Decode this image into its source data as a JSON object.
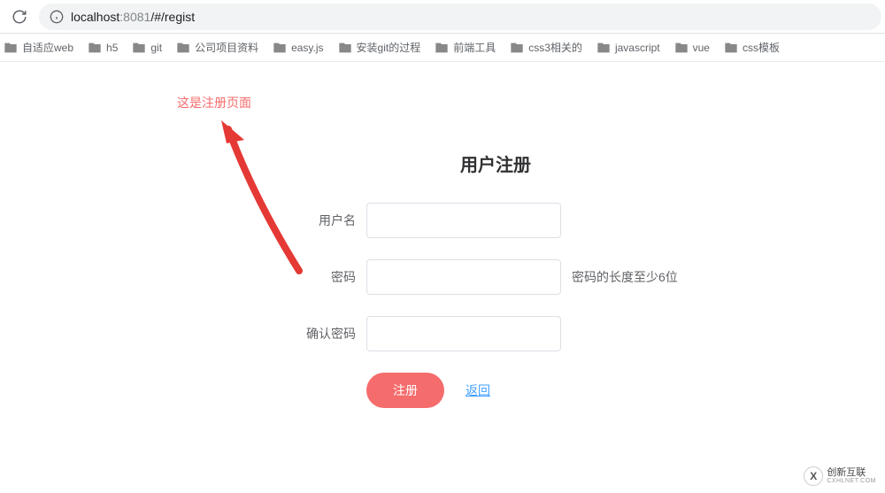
{
  "browser": {
    "url": {
      "host": "localhost",
      "port": ":8081",
      "path": "/#/regist"
    },
    "bookmarks": [
      "自适应web",
      "h5",
      "git",
      "公司项目资料",
      "easy.js",
      "安装git的过程",
      "前端工具",
      "css3相关的",
      "javascript",
      "vue",
      "css模板"
    ]
  },
  "page": {
    "tip": "这是注册页面",
    "title": "用户注册",
    "fields": {
      "username_label": "用户名",
      "password_label": "密码",
      "password_hint": "密码的长度至少6位",
      "confirm_label": "确认密码"
    },
    "actions": {
      "submit": "注册",
      "back": "返回"
    }
  },
  "watermark": {
    "brand": "创新互联",
    "sub": "CXHLNET.COM",
    "glyph": "X"
  }
}
